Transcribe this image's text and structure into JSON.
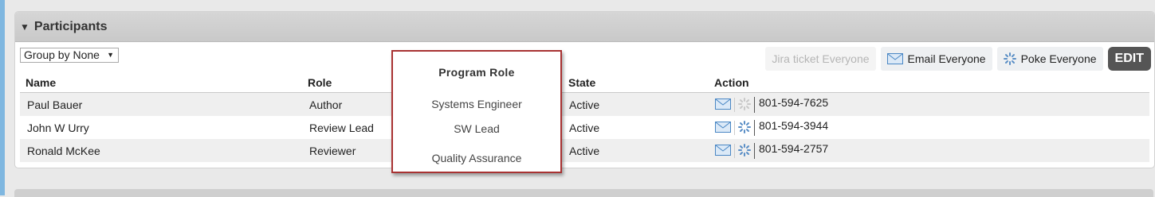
{
  "panel": {
    "title": "Participants"
  },
  "toolbar": {
    "group_by": "Group by None",
    "jira_label": "Jira ticket Everyone",
    "email_label": "Email Everyone",
    "poke_label": "Poke Everyone",
    "edit_label": "EDIT"
  },
  "table": {
    "headers": {
      "name": "Name",
      "role": "Role",
      "state": "State",
      "action": "Action"
    },
    "rows": [
      {
        "name": "Paul Bauer",
        "role": "Author",
        "state": "Active",
        "phone": "801-594-7625"
      },
      {
        "name": "John W Urry",
        "role": "Review Lead",
        "state": "Active",
        "phone": "801-594-3944"
      },
      {
        "name": "Ronald McKee",
        "role": "Reviewer",
        "state": "Active",
        "phone": "801-594-2757"
      }
    ]
  },
  "program_role": {
    "title": "Program Role",
    "items": [
      "Systems Engineer",
      "SW Lead",
      "Quality Assurance"
    ]
  },
  "colors": {
    "overlay_border": "#a83232",
    "header_bg": "#d0d0d0",
    "edit_bg": "#555555",
    "sidebar_accent": "#7fb7e0"
  }
}
